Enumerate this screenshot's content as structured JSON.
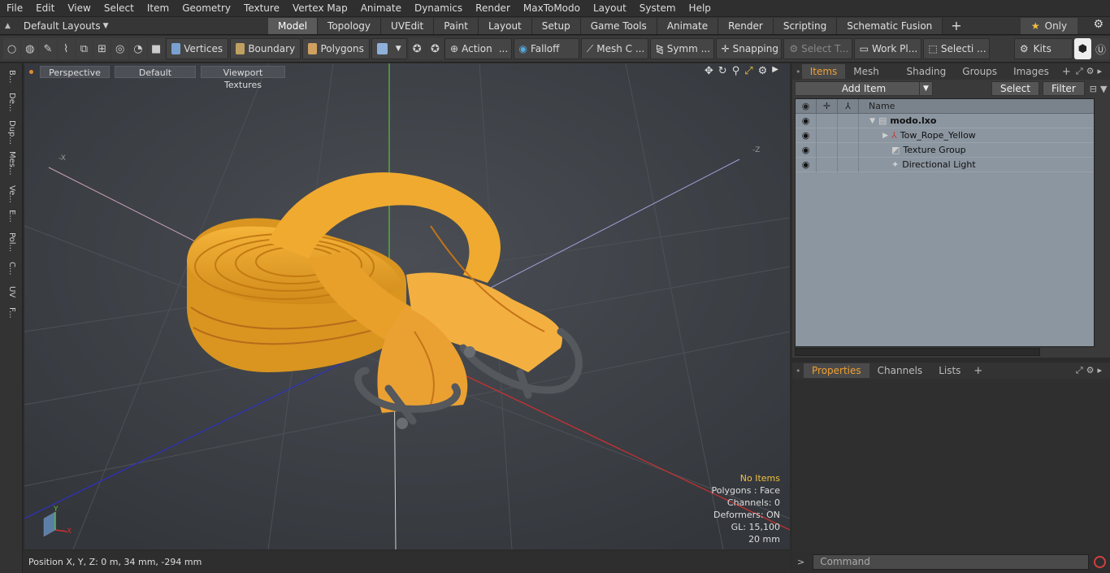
{
  "menubar": {
    "items": [
      "File",
      "Edit",
      "View",
      "Select",
      "Item",
      "Geometry",
      "Texture",
      "Vertex Map",
      "Animate",
      "Dynamics",
      "Render",
      "MaxToModo",
      "Layout",
      "System",
      "Help"
    ]
  },
  "layouts": {
    "label": "Default Layouts"
  },
  "mode_tabs": [
    "Model",
    "Topology",
    "UVEdit",
    "Paint",
    "Layout",
    "Setup",
    "Game Tools",
    "Animate",
    "Render",
    "Scripting",
    "Schematic Fusion"
  ],
  "only_button": "Only",
  "toolbar": {
    "vertices": "Vertices",
    "boundary": "Boundary",
    "polygons": "Polygons",
    "action": "Action",
    "falloff": "Falloff",
    "mesh": "Mesh C ...",
    "symm": "Symm ...",
    "snapping": "Snapping",
    "select_t": "Select T...",
    "workplane": "Work Pl...",
    "selecti": "Selecti ...",
    "kits": "Kits"
  },
  "left_strip": [
    "B...",
    "De...",
    "Dup...",
    "Mes...",
    "Ve...",
    "E...",
    "Pol...",
    "C...",
    "UV",
    "F..."
  ],
  "viewport": {
    "view_mode": "Perspective",
    "shading": "Default",
    "textures": "Viewport Textures",
    "stats": {
      "no_items": "No Items",
      "polygons": "Polygons : Face",
      "channels": "Channels: 0",
      "deformers": "Deformers: ON",
      "gl": "GL: 15,100",
      "scale": "20 mm"
    },
    "axis_x": "X",
    "axis_y": "Y",
    "axis_x_label": "-X",
    "axis_z_label": "-Z"
  },
  "status": {
    "position": "Position X, Y, Z:   0 m, 34 mm, -294 mm"
  },
  "items_panel": {
    "tabs": [
      "Items",
      "Mesh Ops",
      "Shading",
      "Groups",
      "Images"
    ],
    "add_item": "Add Item",
    "select": "Select",
    "filter": "Filter",
    "name_col": "Name",
    "tree": [
      {
        "name": "modo.lxo",
        "bold": true
      },
      {
        "name": "Tow_Rope_Yellow"
      },
      {
        "name": "Texture Group"
      },
      {
        "name": "Directional Light"
      }
    ]
  },
  "properties_panel": {
    "tabs": [
      "Properties",
      "Channels",
      "Lists"
    ]
  },
  "command": {
    "placeholder": "Command"
  }
}
